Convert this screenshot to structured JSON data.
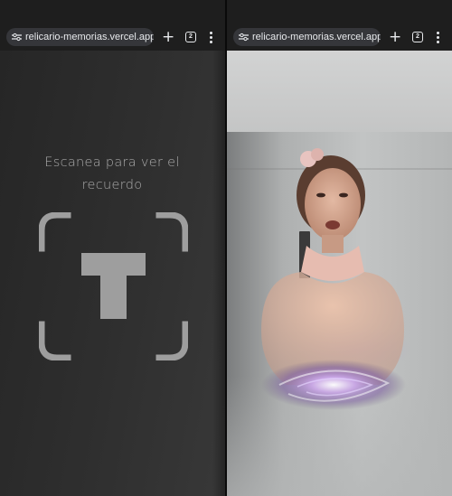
{
  "browser": {
    "url": "relicario-memorias.vercel.app/c",
    "new_tab_label": "+",
    "tab_count": "2",
    "site_settings_icon": "tune-icon",
    "menu_icon": "kebab-icon"
  },
  "left_pane": {
    "scan_prompt": "Escanea para ver el recuerdo",
    "scan_icon": "qr-scanner-frame-icon"
  },
  "right_pane": {
    "scene": "ar-hologram-view"
  },
  "colors": {
    "toolbar_bg": "#1e1e1e",
    "url_pill_bg": "#35363a",
    "scan_text": "#a9a9a9",
    "scan_icon": "#9e9e9e"
  }
}
